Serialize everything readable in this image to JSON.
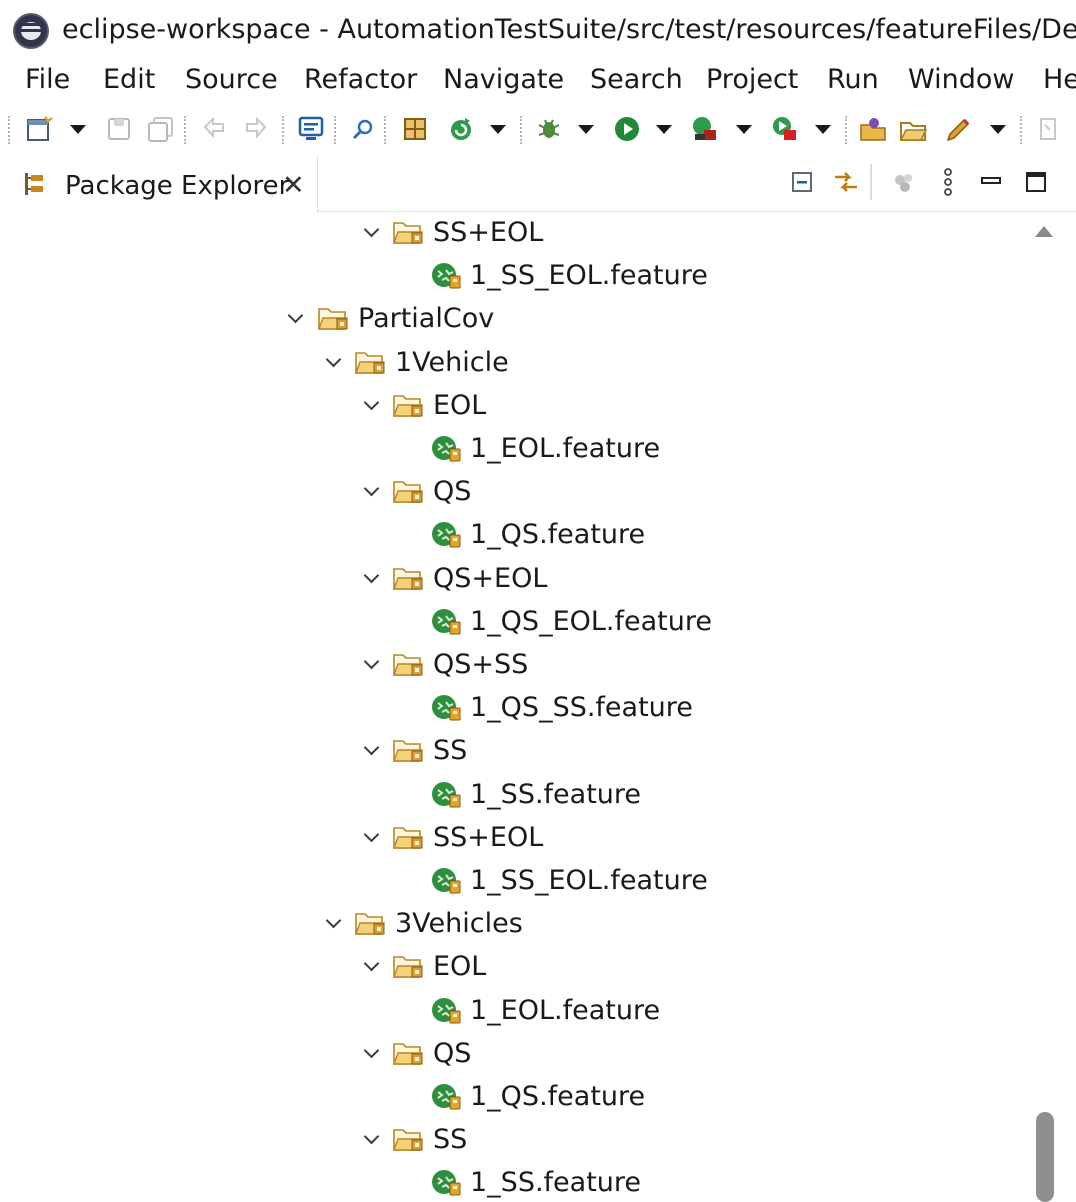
{
  "window": {
    "title": "eclipse-workspace - AutomationTestSuite/src/test/resources/featureFiles/DerivedI",
    "app_icon": "eclipse-icon"
  },
  "menu": {
    "file": "File",
    "edit": "Edit",
    "source": "Source",
    "refactor": "Refactor",
    "navigate": "Navigate",
    "search": "Search",
    "project": "Project",
    "run": "Run",
    "window": "Window",
    "help": "He"
  },
  "toolbar": {
    "icons": [
      "new-icon",
      "save-icon",
      "save-all-icon",
      "undo-nav-icon",
      "redo-nav-icon",
      "console-icon",
      "search-icon",
      "build-icon",
      "refresh-icon",
      "debug-icon",
      "run-icon",
      "run-config-icon",
      "run-last-icon",
      "open-type-icon",
      "open-folder-icon",
      "external-tools-icon",
      "pin-icon"
    ]
  },
  "view": {
    "tab_label": "Package Explorer",
    "tab_close": "✕",
    "actions": [
      "collapse-all-icon",
      "link-with-editor-icon",
      "filter-icon",
      "view-menu-icon",
      "minimize-icon",
      "maximize-icon"
    ]
  },
  "tree": {
    "items": [
      {
        "label": "SS+EOL",
        "kind": "folder"
      },
      {
        "label": "1_SS_EOL.feature",
        "kind": "feature"
      },
      {
        "label": "PartialCov",
        "kind": "folder"
      },
      {
        "label": "1Vehicle",
        "kind": "folder"
      },
      {
        "label": "EOL",
        "kind": "folder"
      },
      {
        "label": "1_EOL.feature",
        "kind": "feature"
      },
      {
        "label": "QS",
        "kind": "folder"
      },
      {
        "label": "1_QS.feature",
        "kind": "feature"
      },
      {
        "label": "QS+EOL",
        "kind": "folder"
      },
      {
        "label": "1_QS_EOL.feature",
        "kind": "feature"
      },
      {
        "label": "QS+SS",
        "kind": "folder"
      },
      {
        "label": "1_QS_SS.feature",
        "kind": "feature"
      },
      {
        "label": "SS",
        "kind": "folder"
      },
      {
        "label": "1_SS.feature",
        "kind": "feature"
      },
      {
        "label": "SS+EOL",
        "kind": "folder"
      },
      {
        "label": "1_SS_EOL.feature",
        "kind": "feature"
      },
      {
        "label": "3Vehicles",
        "kind": "folder"
      },
      {
        "label": "EOL",
        "kind": "folder"
      },
      {
        "label": "1_EOL.feature",
        "kind": "feature"
      },
      {
        "label": "QS",
        "kind": "folder"
      },
      {
        "label": "1_QS.feature",
        "kind": "feature"
      },
      {
        "label": "SS",
        "kind": "folder"
      },
      {
        "label": "1_SS.feature",
        "kind": "feature"
      }
    ]
  },
  "colors": {
    "folder": "#c79a3e",
    "feature": "#1f8a3a",
    "text": "#1a1a1a"
  }
}
